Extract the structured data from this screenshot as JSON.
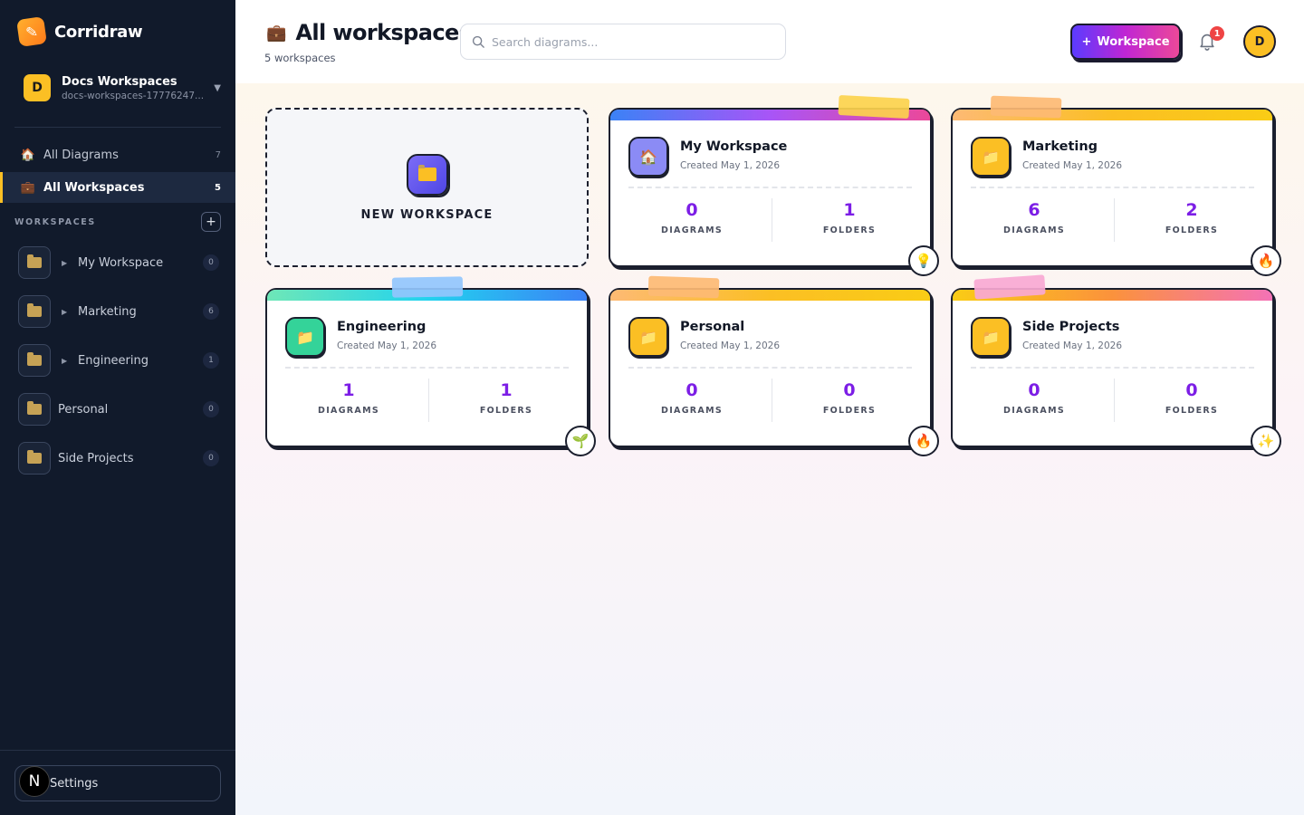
{
  "app": {
    "name": "Corridraw",
    "workspace_name": "Docs Workspaces",
    "workspace_id": "docs-workspaces-17776247...",
    "workspace_initial": "D"
  },
  "sidebar": {
    "nav": [
      {
        "label": "All Diagrams",
        "count": "7",
        "icon": "house-icon"
      },
      {
        "label": "All Workspaces",
        "count": "5",
        "icon": "briefcase-icon"
      }
    ],
    "workspaces_header": "WORKSPACES",
    "workspaces": [
      {
        "label": "My Workspace",
        "count": "0",
        "expandable": true
      },
      {
        "label": "Marketing",
        "count": "6",
        "expandable": true
      },
      {
        "label": "Engineering",
        "count": "1",
        "expandable": true
      },
      {
        "label": "Personal",
        "count": "0",
        "expandable": false
      },
      {
        "label": "Side Projects",
        "count": "0",
        "expandable": false
      }
    ],
    "settings_label": "Settings",
    "bottom_badge": "N"
  },
  "header": {
    "title": "All workspaces",
    "subtitle": "5 workspaces",
    "search_placeholder": "Search diagrams...",
    "new_button": "Workspace",
    "new_button_plus": "+",
    "notifications": "1",
    "user_initial": "D"
  },
  "main": {
    "new_card_label": "NEW WORKSPACE",
    "cards": [
      {
        "name": "My Workspace",
        "created": "Created May 1, 2026",
        "diagrams": "0",
        "diagrams_label": "DIAGRAMS",
        "folders": "1",
        "folders_label": "FOLDERS",
        "emoji": "💡",
        "icon": "🏠",
        "colors": {
          "stripe": "linear-gradient(90deg,#3b82f6,#a855f7,#ec4899)",
          "tape": "#fcd34d",
          "icon_bg": "#8b8bf5"
        }
      },
      {
        "name": "Marketing",
        "created": "Created May 1, 2026",
        "diagrams": "6",
        "diagrams_label": "DIAGRAMS",
        "folders": "2",
        "folders_label": "FOLDERS",
        "emoji": "🔥",
        "icon": "📁",
        "colors": {
          "stripe": "linear-gradient(90deg,#fdba74,#fbbf24,#facc15)",
          "tape": "#fdba74",
          "icon_bg": "#fbbf24"
        }
      },
      {
        "name": "Engineering",
        "created": "Created May 1, 2026",
        "diagrams": "1",
        "diagrams_label": "DIAGRAMS",
        "folders": "1",
        "folders_label": "FOLDERS",
        "emoji": "🌱",
        "icon": "📁",
        "colors": {
          "stripe": "linear-gradient(90deg,#6ee7b7,#22d3ee,#3b82f6)",
          "tape": "#93c5fd",
          "icon_bg": "#34d399"
        }
      },
      {
        "name": "Personal",
        "created": "Created May 1, 2026",
        "diagrams": "0",
        "diagrams_label": "DIAGRAMS",
        "folders": "0",
        "folders_label": "FOLDERS",
        "emoji": "🔥",
        "icon": "📁",
        "colors": {
          "stripe": "linear-gradient(90deg,#fdba74,#fbbf24,#facc15)",
          "tape": "#fdba74",
          "icon_bg": "#fbbf24"
        }
      },
      {
        "name": "Side Projects",
        "created": "Created May 1, 2026",
        "diagrams": "0",
        "diagrams_label": "DIAGRAMS",
        "folders": "0",
        "folders_label": "FOLDERS",
        "emoji": "✨",
        "icon": "📁",
        "colors": {
          "stripe": "linear-gradient(90deg,#facc15,#fb923c,#f472b6)",
          "tape": "#f9a8d4",
          "icon_bg": "#fbbf24"
        }
      }
    ]
  }
}
